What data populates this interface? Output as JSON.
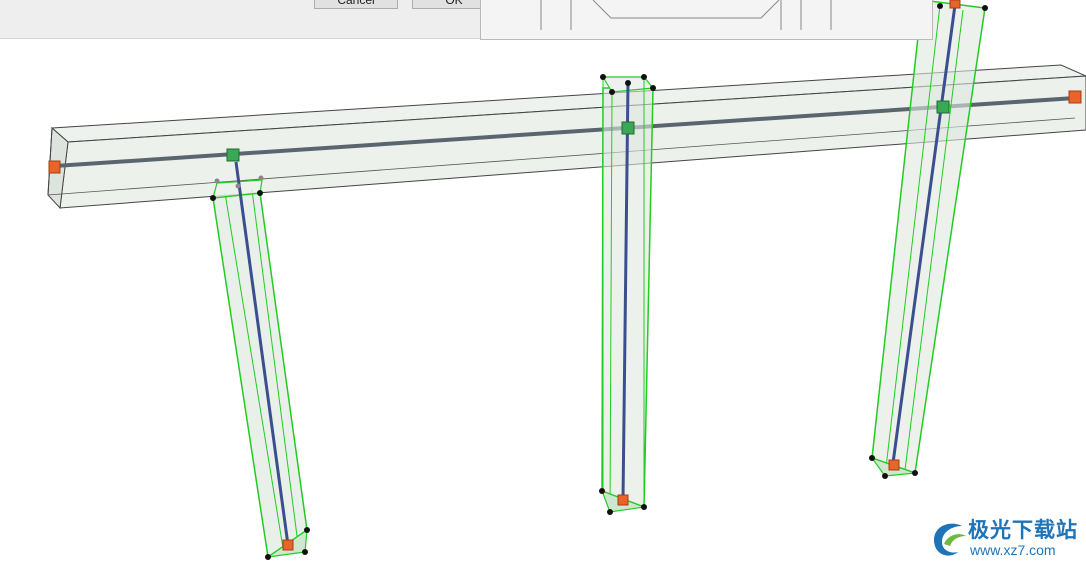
{
  "dialog": {
    "cancel_label": "Cancel",
    "ok_label": "OK"
  },
  "watermark": {
    "name": "极光下载站",
    "url": "www.xz7.com"
  },
  "colors": {
    "beam_fill": "#dfe8df",
    "beam_edge": "#3a3a3a",
    "column_edge_selected": "#22cc22",
    "axis_line": "#3b4f8f",
    "handle_green": "#3aa856",
    "handle_orange": "#e8652a",
    "vertex_point": "#111111"
  }
}
